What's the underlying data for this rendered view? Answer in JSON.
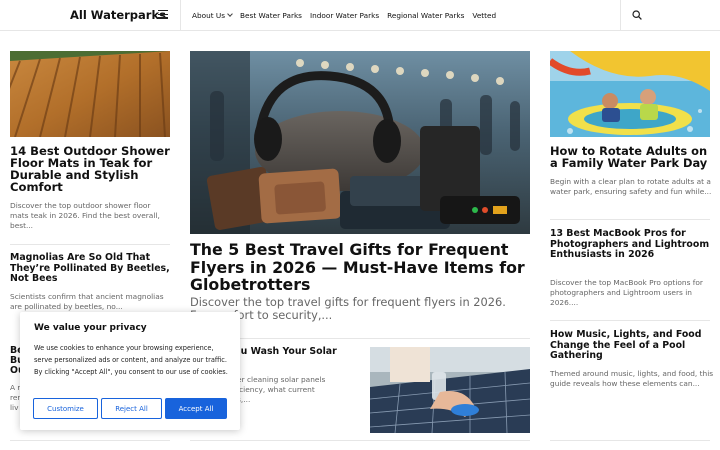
{
  "header": {
    "logo": "All Waterparks",
    "nav": [
      {
        "label": "About Us",
        "has_dropdown": true
      },
      {
        "label": "Best Water Parks"
      },
      {
        "label": "Indoor Water Parks"
      },
      {
        "label": "Regional Water Parks"
      },
      {
        "label": "Vetted"
      }
    ]
  },
  "left": {
    "card1": {
      "title": "14 Best Outdoor Shower Floor Mats in Teak for Durable and Stylish Comfort",
      "excerpt": "Discover the top outdoor shower floor mats teak in 2026. Find the best overall, best..."
    },
    "card2": {
      "title": "Magnolias Are So Old That They’re Pollinated By Beetles, Not Bees",
      "excerpt": "Scientists confirm that ancient magnolias are pollinated by beetles, no..."
    },
    "card3": {
      "title_lines": [
        "Be",
        "Bu",
        "Ou"
      ],
      "excerpt_lines": [
        "A r",
        "rer",
        "liv"
      ]
    }
  },
  "center": {
    "feature": {
      "title": "The 5 Best Travel Gifts for Frequent Flyers in 2026 — Must-Have Items for Globetrotters",
      "excerpt_line1": "Discover the top travel gifts for frequent flyers in 2026.",
      "excerpt_line2": "F... comfort to security,..."
    },
    "card2": {
      "title": "...u Wash Your Solar",
      "excerpt_line1": "...er cleaning solar panels",
      "excerpt_line2": "...iciency, what current",
      "excerpt_line3": "...s,..."
    }
  },
  "right": {
    "card1": {
      "title": "How to Rotate Adults on a Family Water Park Day",
      "excerpt": "Begin with a clear plan to rotate adults at a water park, ensuring safety and fun while..."
    },
    "card2": {
      "title": "13 Best MacBook Pros for Photographers and Lightroom Enthusiasts in 2026",
      "excerpt": "Discover the top MacBook Pro options for photographers and Lightroom users in 2026...."
    },
    "card3": {
      "title": "How Music, Lights, and Food Change the Feel of a Pool Gathering",
      "excerpt": "Themed around music, lights, and food, this guide reveals how these elements can..."
    }
  },
  "cookie": {
    "title": "We value your privacy",
    "body": "We use cookies to enhance your browsing experience, serve personalized ads or content, and analyze our traffic. By clicking \"Accept All\", you consent to our use of cookies.",
    "customize": "Customize",
    "reject": "Reject All",
    "accept": "Accept All"
  },
  "colors": {
    "accent": "#1863dc",
    "muted_text": "#666666",
    "divider": "#e6e6e6"
  }
}
